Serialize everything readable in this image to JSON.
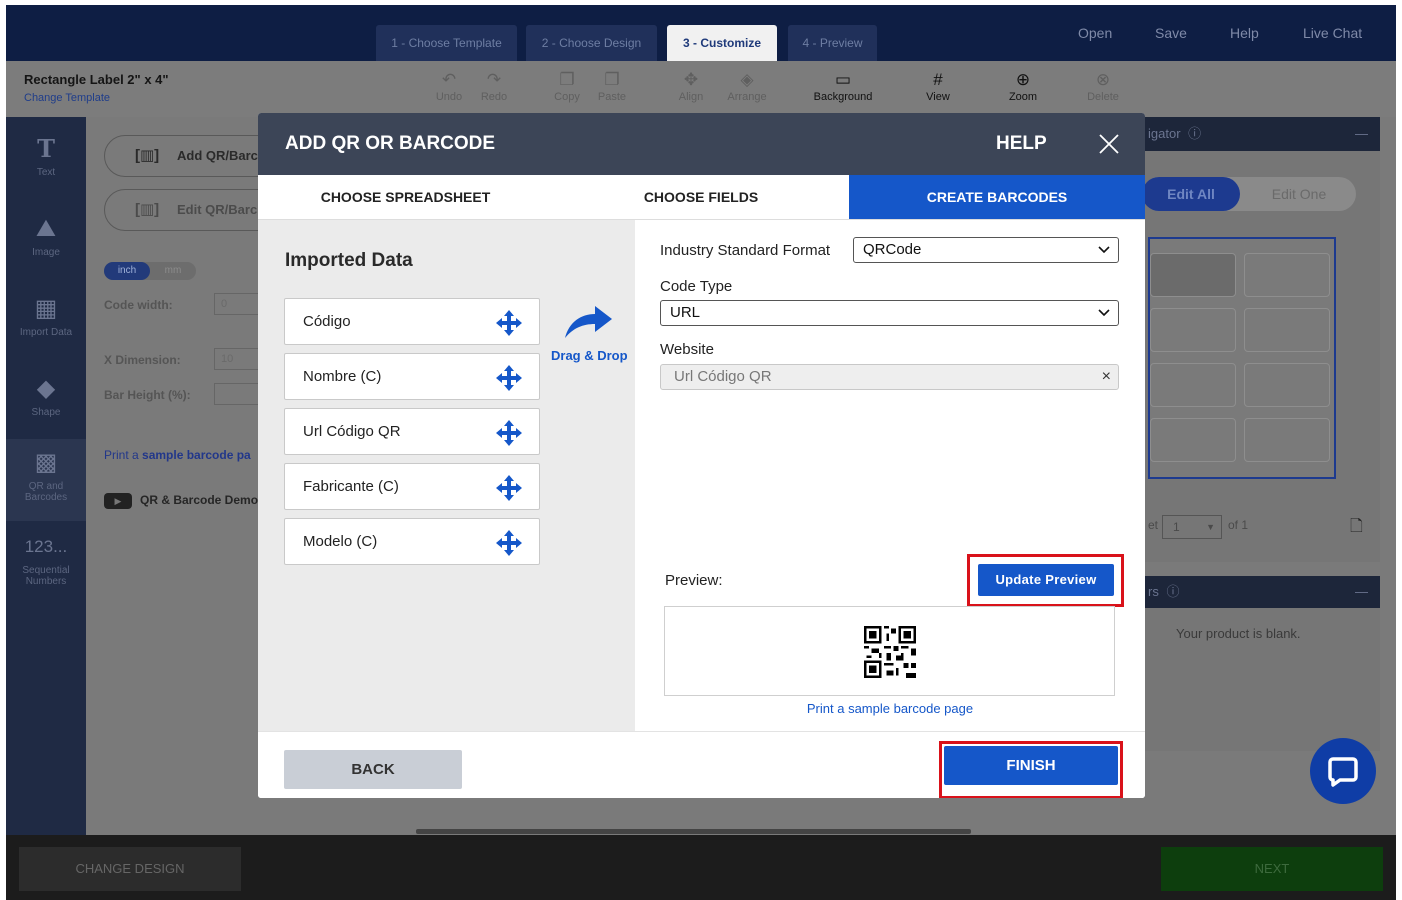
{
  "steps": [
    {
      "label": "1 - Choose Template"
    },
    {
      "label": "2 - Choose Design"
    },
    {
      "label": "3 - Customize"
    },
    {
      "label": "4 - Preview"
    }
  ],
  "top_links": {
    "open": "Open",
    "save": "Save",
    "help": "Help",
    "live_chat": "Live Chat"
  },
  "label_info": {
    "title": "Rectangle Label 2\" x 4\"",
    "change_template": "Change Template"
  },
  "toolbar": {
    "undo": "Undo",
    "redo": "Redo",
    "copy": "Copy",
    "paste": "Paste",
    "align": "Align",
    "arrange": "Arrange",
    "background": "Background",
    "view": "View",
    "zoom": "Zoom",
    "delete": "Delete"
  },
  "sidebar": {
    "text": "Text",
    "image": "Image",
    "import_data": "Import Data",
    "shape": "Shape",
    "qr_barcodes_line1": "QR and",
    "qr_barcodes_line2": "Barcodes",
    "sequential_icon": "123...",
    "sequential_line1": "Sequential",
    "sequential_line2": "Numbers"
  },
  "left_panel": {
    "add_qr": "Add QR/Barc",
    "edit_qr": "Edit QR/Barc",
    "unit_inch": "inch",
    "unit_mm": "mm",
    "code_width_label": "Code width:",
    "code_width_value": "0",
    "x_dimension_label": "X Dimension:",
    "x_dimension_value": "10",
    "bar_height_label": "Bar Height (%):",
    "sample_prefix": "Print a ",
    "sample_link": "sample barcode pa",
    "demo": "QR & Barcode Demo"
  },
  "navigator": {
    "title": "igator",
    "edit_all": "Edit All",
    "edit_one": "Edit One",
    "sheet_prefix": "et",
    "sheet_value": "1",
    "sheet_of": "of 1"
  },
  "layers": {
    "title": "rs",
    "blank": "Your product is blank."
  },
  "bottom": {
    "change_design": "CHANGE DESIGN",
    "next": "NEXT"
  },
  "modal": {
    "title": "ADD QR OR BARCODE",
    "help": "HELP",
    "tabs": [
      {
        "label": "CHOOSE SPREADSHEET"
      },
      {
        "label": "CHOOSE FIELDS"
      },
      {
        "label": "CREATE BARCODES"
      }
    ],
    "imported_title": "Imported Data",
    "fields": [
      {
        "label": "Código"
      },
      {
        "label": "Nombre (C)"
      },
      {
        "label": "Url Código QR"
      },
      {
        "label": "Fabricante (C)"
      },
      {
        "label": "Modelo (C)"
      }
    ],
    "drag_drop": "Drag & Drop",
    "format_label": "Industry Standard Format",
    "format_value": "QRCode",
    "code_type_label": "Code Type",
    "code_type_value": "URL",
    "website_label": "Website",
    "website_value": "Url Código QR",
    "preview_label": "Preview:",
    "update_preview": "Update Preview",
    "sample_barcode": "Print a sample barcode page",
    "back": "BACK",
    "finish": "FINISH"
  },
  "colors": {
    "accent": "#1557c9",
    "highlight": "#d9121a",
    "modal_header": "#3c4557"
  }
}
